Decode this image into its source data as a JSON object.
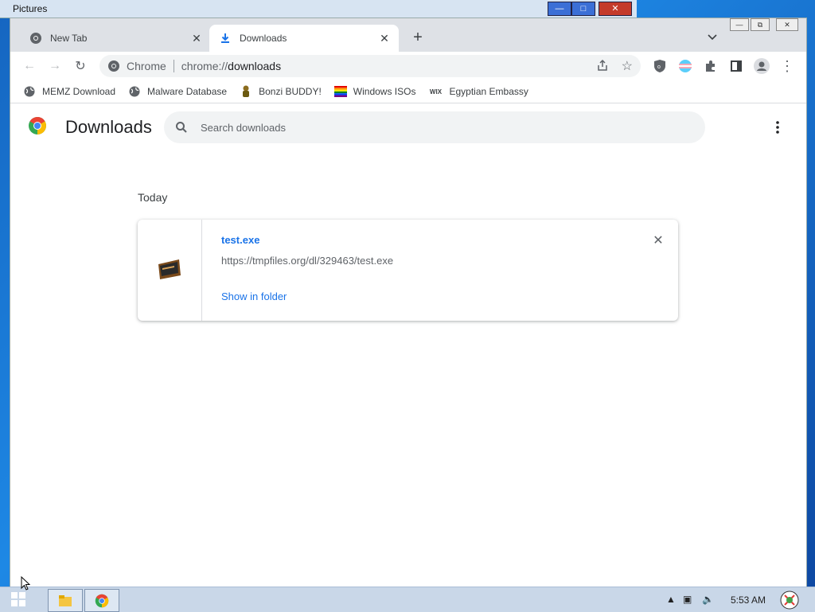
{
  "background_window": {
    "title": "Pictures"
  },
  "tabs": [
    {
      "label": "New Tab",
      "icon": "chrome-icon",
      "active": false
    },
    {
      "label": "Downloads",
      "icon": "download-icon",
      "active": true
    }
  ],
  "toolbar": {
    "site_label": "Chrome",
    "url_scheme": "chrome://",
    "url_host": "downloads"
  },
  "bookmarks": [
    {
      "label": "MEMZ Download",
      "icon": "globe-icon"
    },
    {
      "label": "Malware Database",
      "icon": "globe-icon"
    },
    {
      "label": "Bonzi BUDDY!",
      "icon": "bonzi-icon"
    },
    {
      "label": "Windows ISOs",
      "icon": "rainbow-flag-icon"
    },
    {
      "label": "Egyptian Embassy",
      "icon": "wix-icon",
      "icon_text": "WIX"
    }
  ],
  "downloads_page": {
    "title": "Downloads",
    "search_placeholder": "Search downloads",
    "date_heading": "Today",
    "items": [
      {
        "filename": "test.exe",
        "url": "https://tmpfiles.org/dl/329463/test.exe",
        "action": "Show in folder"
      }
    ]
  },
  "taskbar": {
    "clock": "5:53 AM"
  },
  "colors": {
    "link_blue": "#1a73e8",
    "tabstrip_bg": "#dee1e6",
    "omnibox_bg": "#f1f3f4"
  }
}
